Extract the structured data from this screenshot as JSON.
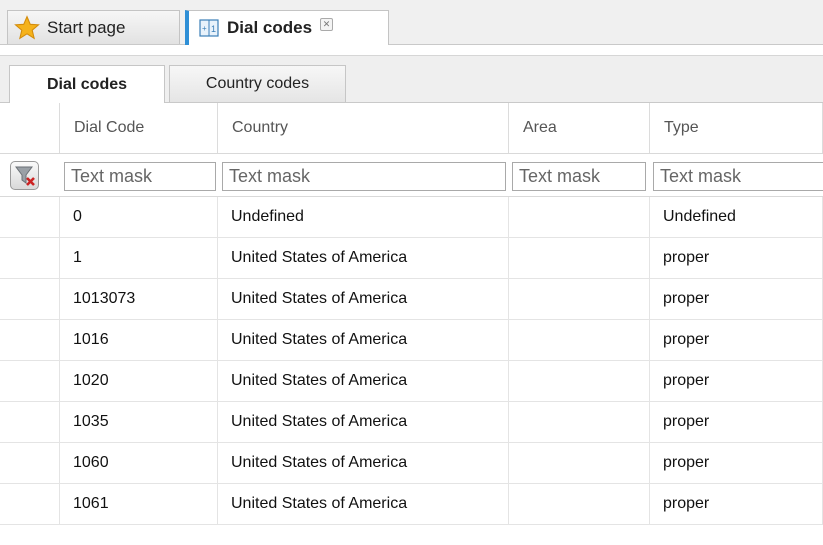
{
  "top_tabs": [
    {
      "label": "Start page",
      "icon": "star-icon"
    },
    {
      "label": "Dial codes",
      "icon": "book-icon",
      "closable": true
    }
  ],
  "sub_tabs": [
    {
      "label": "Dial codes",
      "active": true
    },
    {
      "label": "Country codes",
      "active": false
    }
  ],
  "grid": {
    "columns": [
      "Dial Code",
      "Country",
      "Area",
      "Type"
    ],
    "filter_placeholder": "Text mask",
    "rows": [
      {
        "dial_code": "0",
        "country": "Undefined",
        "area": "",
        "type": "Undefined"
      },
      {
        "dial_code": "1",
        "country": "United States of America",
        "area": "",
        "type": "proper"
      },
      {
        "dial_code": "1013073",
        "country": "United States of America",
        "area": "",
        "type": "proper"
      },
      {
        "dial_code": "1016",
        "country": "United States of America",
        "area": "",
        "type": "proper"
      },
      {
        "dial_code": "1020",
        "country": "United States of America",
        "area": "",
        "type": "proper"
      },
      {
        "dial_code": "1035",
        "country": "United States of America",
        "area": "",
        "type": "proper"
      },
      {
        "dial_code": "1060",
        "country": "United States of America",
        "area": "",
        "type": "proper"
      },
      {
        "dial_code": "1061",
        "country": "United States of America",
        "area": "",
        "type": "proper"
      }
    ]
  },
  "colors": {
    "accent": "#2f8fd6",
    "star": "#f5b21b",
    "filter_clear": "#cc2222"
  }
}
